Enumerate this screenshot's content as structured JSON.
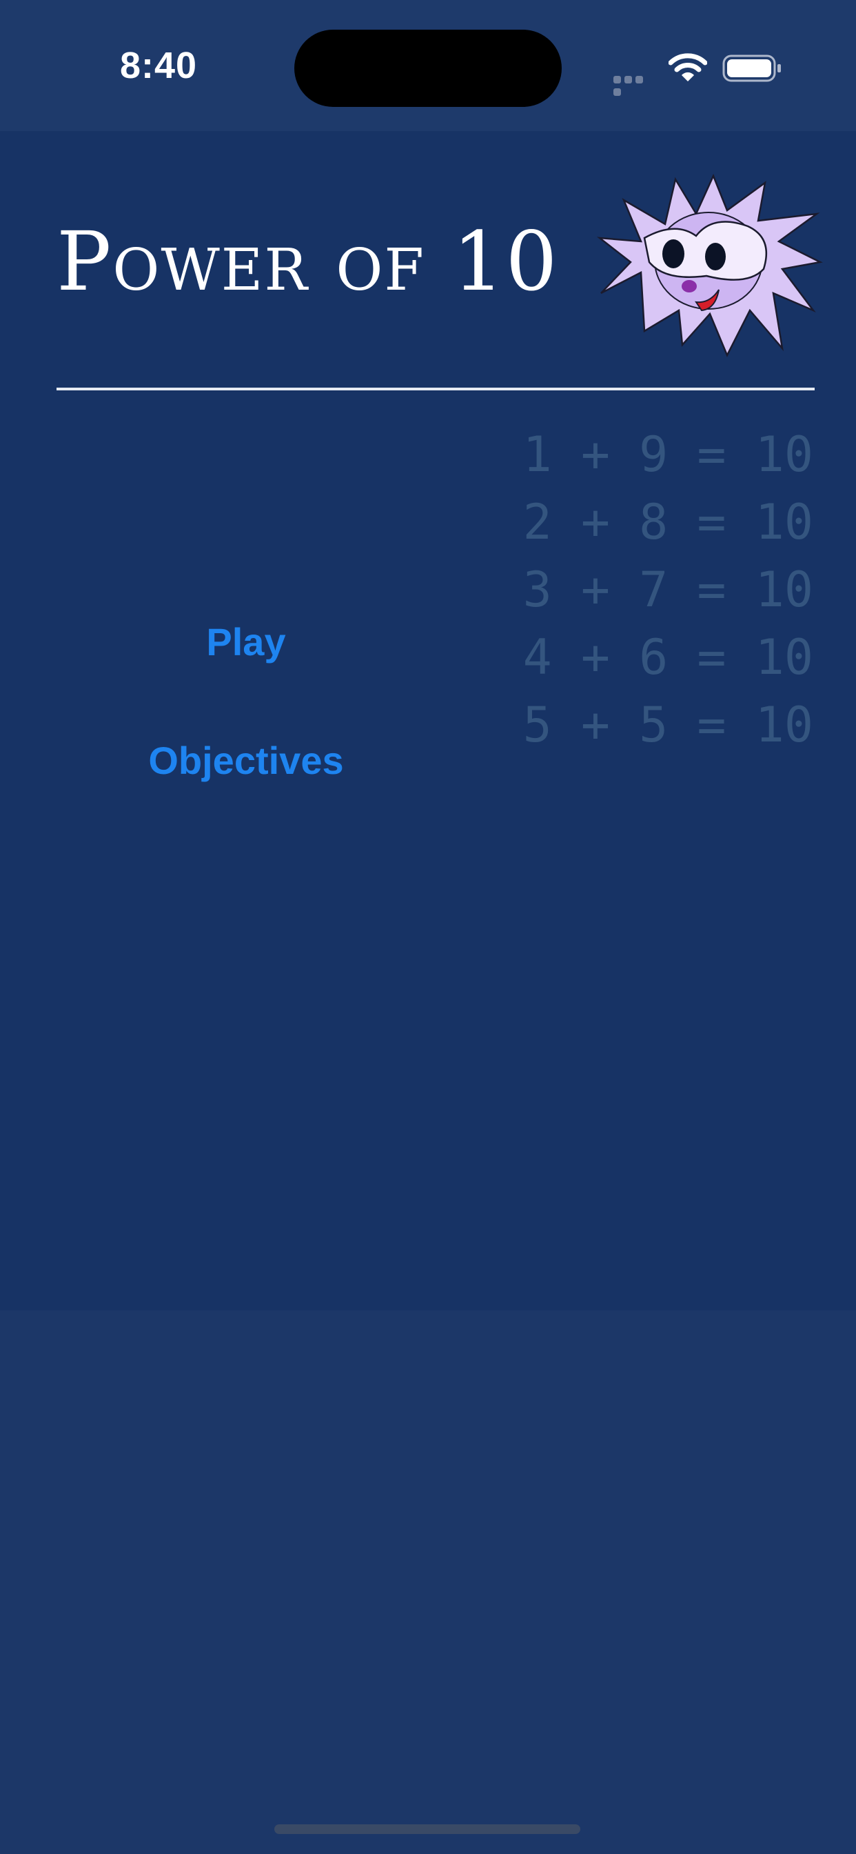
{
  "status_bar": {
    "time": "8:40",
    "icons": [
      "signal-icon",
      "wifi-icon",
      "battery-icon"
    ]
  },
  "header": {
    "title": "Power of 10",
    "mascot": "spiky-creature-mascot"
  },
  "equations": [
    "1 + 9 = 10",
    "2 + 8 = 10",
    "3 + 7 = 10",
    "4 + 6 = 10",
    "5 + 5 = 10"
  ],
  "menu": {
    "play_label": "Play",
    "objectives_label": "Objectives"
  },
  "colors": {
    "background": "#1c3768",
    "panel": "#173365",
    "title_text": "#ffffff",
    "button_text": "#1e84f0",
    "equation_text": "#34557f",
    "mascot_fill": "#d8c4f5"
  }
}
